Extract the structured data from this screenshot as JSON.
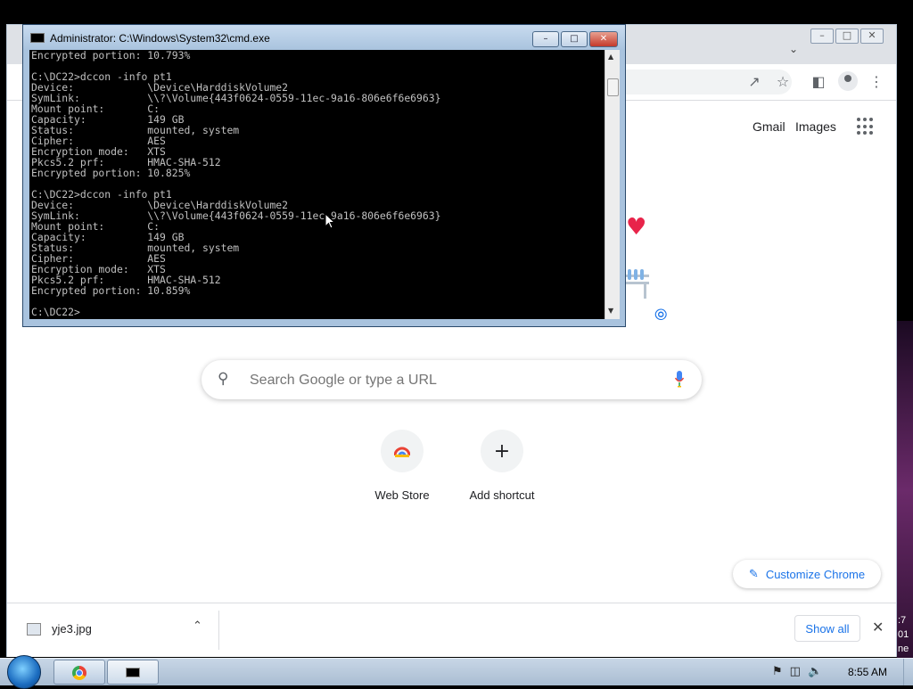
{
  "chrome": {
    "top_links": [
      "Gmail",
      "Images"
    ],
    "search_placeholder": "Search Google or type a URL",
    "shortcuts": [
      {
        "label": "Web Store",
        "icon": "webstore-icon"
      },
      {
        "label": "Add shortcut",
        "icon": "plus-icon",
        "glyph": "+"
      }
    ],
    "customize_label": "Customize Chrome",
    "downloads": {
      "file_name": "yje3.jpg",
      "show_all": "Show all"
    }
  },
  "cmd": {
    "title": "Administrator: C:\\Windows\\System32\\cmd.exe",
    "lines": [
      "Encrypted portion: 10.793%",
      "",
      "C:\\DC22>dccon -info pt1",
      "Device:            \\Device\\HarddiskVolume2",
      "SymLink:           \\\\?\\Volume{443f0624-0559-11ec-9a16-806e6f6e6963}",
      "Mount point:       C:",
      "Capacity:          149 GB",
      "Status:            mounted, system",
      "Cipher:            AES",
      "Encryption mode:   XTS",
      "Pkcs5.2 prf:       HMAC-SHA-512",
      "Encrypted portion: 10.825%",
      "",
      "C:\\DC22>dccon -info pt1",
      "Device:            \\Device\\HarddiskVolume2",
      "SymLink:           \\\\?\\Volume{443f0624-0559-11ec-9a16-806e6f6e6963}",
      "Mount point:       C:",
      "Capacity:          149 GB",
      "Status:            mounted, system",
      "Cipher:            AES",
      "Encryption mode:   XTS",
      "Pkcs5.2 prf:       HMAC-SHA-512",
      "Encrypted portion: 10.859%",
      "",
      "C:\\DC22>"
    ]
  },
  "taskbar": {
    "clock": "8:55 AM",
    "desktop_clock_fragment": [
      ":7",
      "01",
      "ne"
    ]
  },
  "colors": {
    "accent": "#1a73e8",
    "heart": "#e8244a",
    "console_bg": "#000000",
    "console_text": "#c0c0c0"
  }
}
